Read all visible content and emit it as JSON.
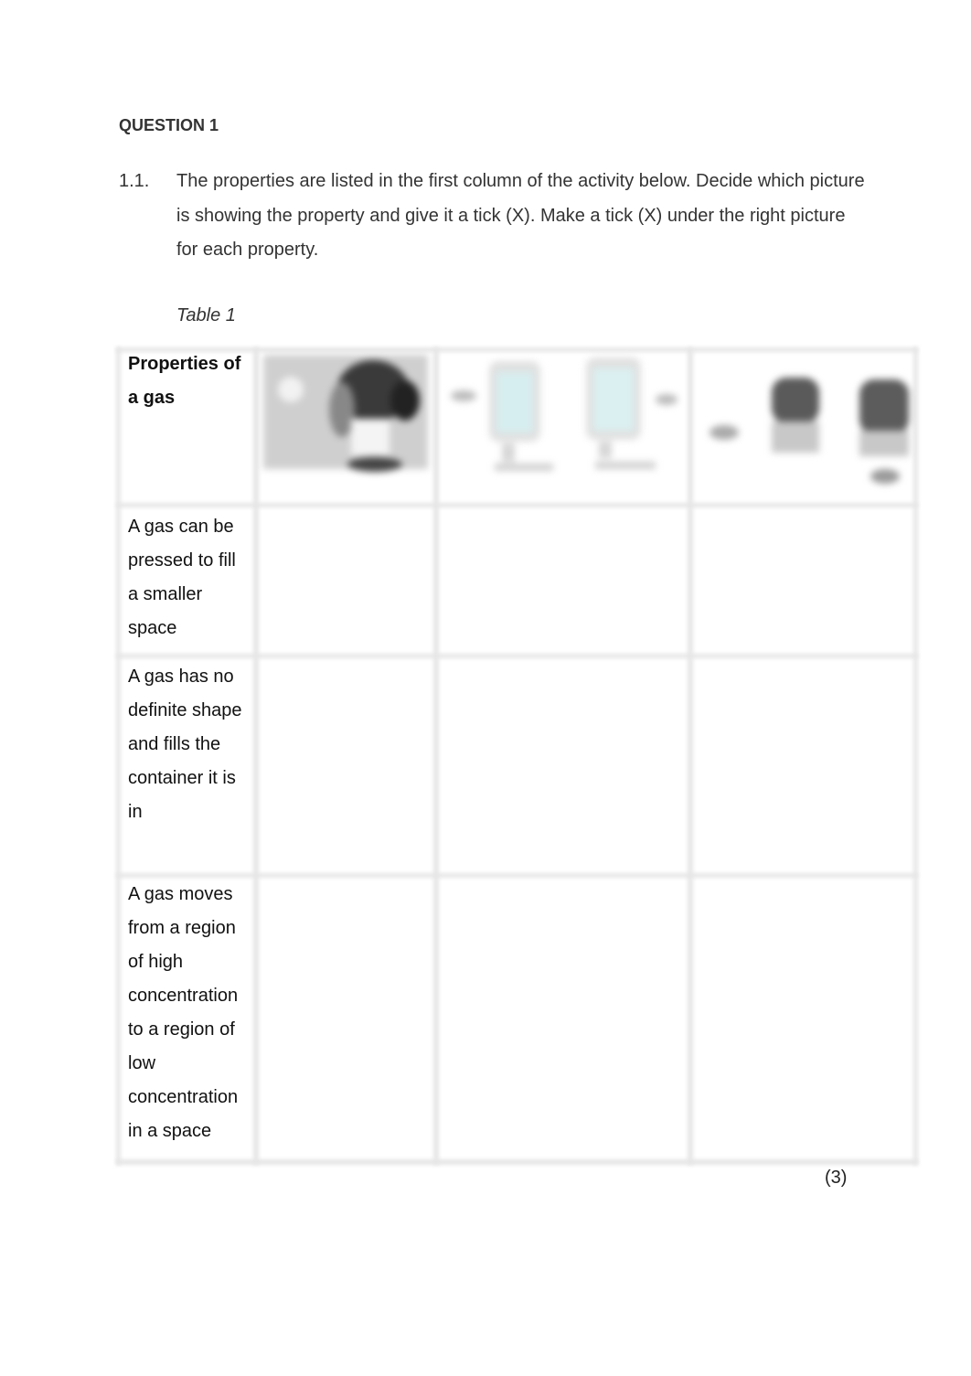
{
  "question": {
    "title": "QUESTION 1",
    "item_number": "1.1.",
    "instruction": "The properties are listed in the first column of the activity below. Decide which picture is showing the property and give it a tick (X). Make a tick (X) under the right picture for each property.",
    "table_caption": "Table 1"
  },
  "table": {
    "header": {
      "label": "Properties of a gas",
      "pictures": [
        {
          "icon": "person-smelling-icon"
        },
        {
          "icon": "syringe-compression-icon"
        },
        {
          "icon": "gas-jar-diffusion-icon"
        }
      ]
    },
    "rows": [
      {
        "property": "A gas can be pressed to fill a smaller space",
        "ticks": [
          "",
          "",
          ""
        ]
      },
      {
        "property": "A gas has no definite shape and fills the container it is in",
        "ticks": [
          "",
          "",
          ""
        ]
      },
      {
        "property": "A gas moves from a region of high concentration to a region of low concentration in a space",
        "ticks": [
          "",
          "",
          ""
        ]
      }
    ]
  },
  "marks": "(3)"
}
